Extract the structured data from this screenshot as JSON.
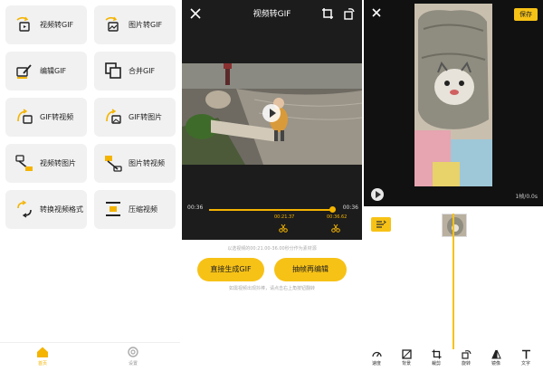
{
  "panel1": {
    "tiles": [
      {
        "label": "视频转GIF",
        "icon": "video-to-gif-icon"
      },
      {
        "label": "图片转GIF",
        "icon": "image-to-gif-icon"
      },
      {
        "label": "编辑GIF",
        "icon": "edit-gif-icon"
      },
      {
        "label": "合并GIF",
        "icon": "merge-gif-icon"
      },
      {
        "label": "GIF转视频",
        "icon": "gif-to-video-icon"
      },
      {
        "label": "GIF转图片",
        "icon": "gif-to-image-icon"
      },
      {
        "label": "视频转图片",
        "icon": "video-to-image-icon"
      },
      {
        "label": "图片转视频",
        "icon": "image-to-video-icon"
      },
      {
        "label": "转换视频格式",
        "icon": "convert-format-icon"
      },
      {
        "label": "压缩视频",
        "icon": "compress-video-icon"
      }
    ],
    "nav": [
      {
        "label": "首页",
        "icon": "home-icon"
      },
      {
        "label": "设置",
        "icon": "settings-icon"
      }
    ]
  },
  "panel2": {
    "title": "视频转GIF",
    "time_start": "00:36",
    "time_end": "00:36",
    "marker_start": "00:21.37",
    "marker_end": "00:36.62",
    "hint_top": "以选视频的00:21.00-36.00秒分作为素材源",
    "button_direct": "直接生成GIF",
    "button_extract": "抽帧再编辑",
    "hint_bottom": "如需视频出现抖棒，请点击右上角按钮翻转",
    "progress": 0.96
  },
  "panel3": {
    "save": "保存",
    "rate": "1帧/0.0s",
    "tools": [
      {
        "label": "速度",
        "icon": "speed-icon"
      },
      {
        "label": "背景",
        "icon": "background-icon"
      },
      {
        "label": "裁剪",
        "icon": "crop-icon"
      },
      {
        "label": "旋转",
        "icon": "rotate-icon"
      },
      {
        "label": "镜像",
        "icon": "mirror-icon"
      },
      {
        "label": "文字",
        "icon": "text-icon"
      }
    ]
  },
  "colors": {
    "accent": "#F7C216",
    "dark": "#1C1C1C",
    "tile": "#F1F1F1"
  }
}
